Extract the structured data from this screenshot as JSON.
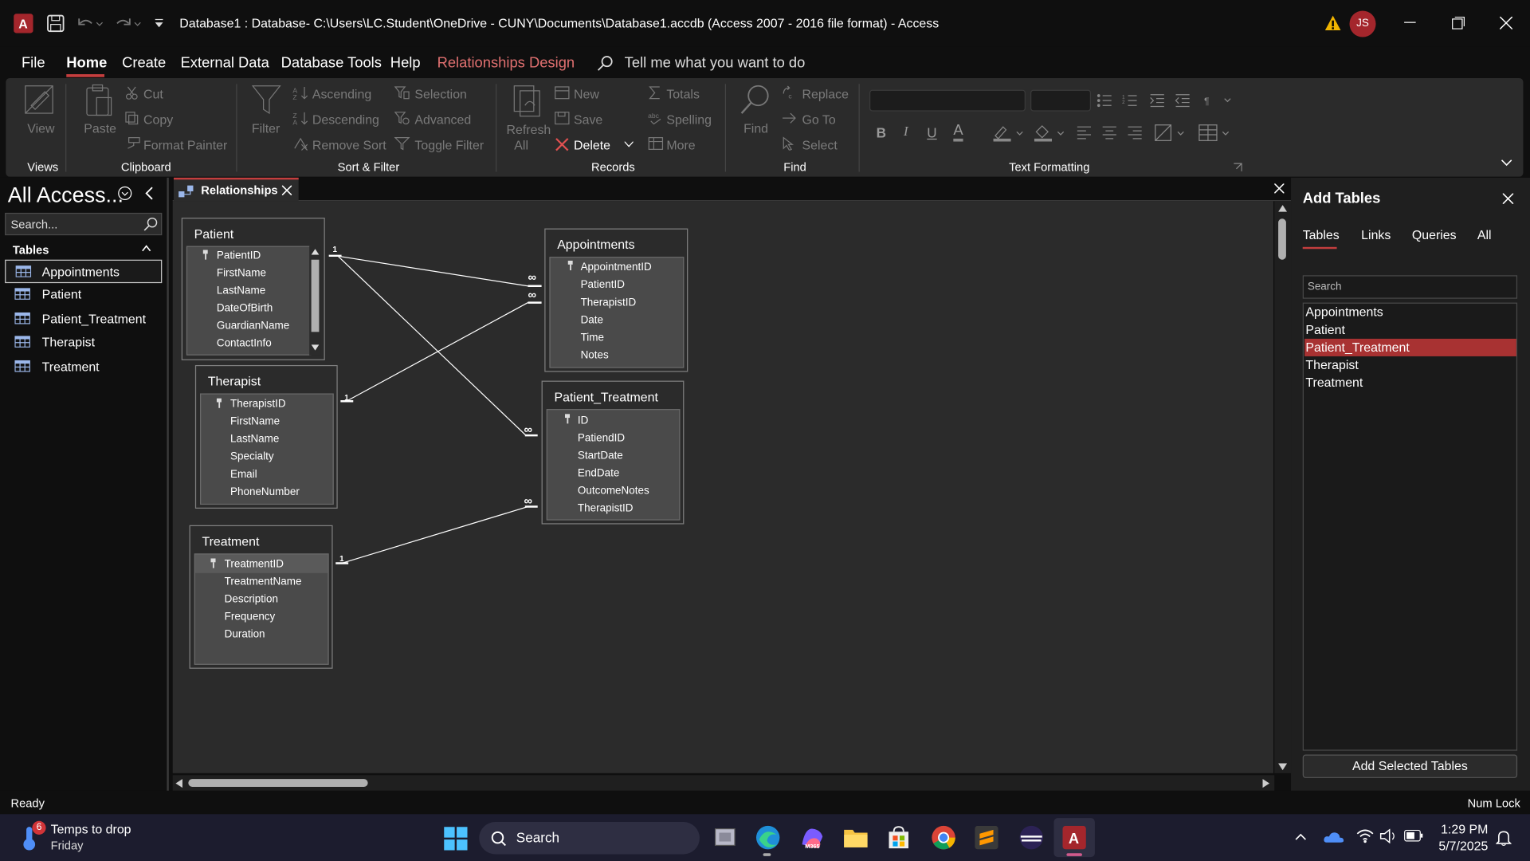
{
  "titlebar": {
    "title": "Database1 : Database- C:\\Users\\LC.Student\\OneDrive - CUNY\\Documents\\Database1.accdb (Access 2007 - 2016 file format)  -  Access",
    "avatar": "JS"
  },
  "menu": {
    "items": [
      "File",
      "Home",
      "Create",
      "External Data",
      "Database Tools",
      "Help",
      "Relationships Design"
    ],
    "search": "Tell me what you want to do"
  },
  "ribbon": {
    "views": {
      "view": "View",
      "group": "Views"
    },
    "clipboard": {
      "paste": "Paste",
      "cut": "Cut",
      "copy": "Copy",
      "format_painter": "Format Painter",
      "group": "Clipboard"
    },
    "sort_filter": {
      "filter": "Filter",
      "ascending": "Ascending",
      "descending": "Descending",
      "remove_sort": "Remove Sort",
      "selection": "Selection",
      "advanced": "Advanced",
      "toggle_filter": "Toggle Filter",
      "group": "Sort & Filter"
    },
    "records": {
      "refresh": "Refresh",
      "refresh_all": "All",
      "new": "New",
      "save": "Save",
      "delete": "Delete",
      "totals": "Totals",
      "spelling": "Spelling",
      "more": "More",
      "group": "Records"
    },
    "find": {
      "find": "Find",
      "replace": "Replace",
      "goto": "Go To",
      "select": "Select",
      "group": "Find"
    },
    "text_formatting": {
      "bold": "B",
      "italic": "I",
      "underline": "U",
      "font_color": "A",
      "group": "Text Formatting"
    }
  },
  "nav": {
    "title": "All Access...",
    "search_placeholder": "Search...",
    "section": "Tables",
    "items": [
      "Appointments",
      "Patient",
      "Patient_Treatment",
      "Therapist",
      "Treatment"
    ]
  },
  "doc_tab": {
    "label": "Relationships"
  },
  "tables": {
    "patient": {
      "name": "Patient",
      "fields": [
        "PatientID",
        "FirstName",
        "LastName",
        "DateOfBirth",
        "GuardianName",
        "ContactInfo"
      ]
    },
    "therapist": {
      "name": "Therapist",
      "fields": [
        "TherapistID",
        "FirstName",
        "LastName",
        "Specialty",
        "Email",
        "PhoneNumber"
      ]
    },
    "treatment": {
      "name": "Treatment",
      "fields": [
        "TreatmentID",
        "TreatmentName",
        "Description",
        "Frequency",
        "Duration"
      ]
    },
    "appointments": {
      "name": "Appointments",
      "fields": [
        "AppointmentID",
        "PatientID",
        "TherapistID",
        "Date",
        "Time",
        "Notes"
      ]
    },
    "patient_treatment": {
      "name": "Patient_Treatment",
      "fields": [
        "ID",
        "PatiendID",
        "StartDate",
        "EndDate",
        "OutcomeNotes",
        "TherapistID"
      ]
    }
  },
  "relationship_marks": {
    "one": "1",
    "many": "∞"
  },
  "add_tables": {
    "title": "Add Tables",
    "tabs": [
      "Tables",
      "Links",
      "Queries",
      "All"
    ],
    "search_placeholder": "Search",
    "items": [
      "Appointments",
      "Patient",
      "Patient_Treatment",
      "Therapist",
      "Treatment"
    ],
    "selected": "Patient_Treatment",
    "button": "Add Selected Tables"
  },
  "status": {
    "left": "Ready",
    "right": "Num Lock"
  },
  "taskbar": {
    "weather_badge": "6",
    "weather_title": "Temps to drop",
    "weather_day": "Friday",
    "search": "Search",
    "time": "1:29 PM",
    "date": "5/7/2025"
  },
  "colors": {
    "accent": "#c43e3e",
    "highlight": "#a83232",
    "background": "#0f0f0f",
    "canvas": "#2b2b2b",
    "table_fields": "#4a4a4a"
  }
}
